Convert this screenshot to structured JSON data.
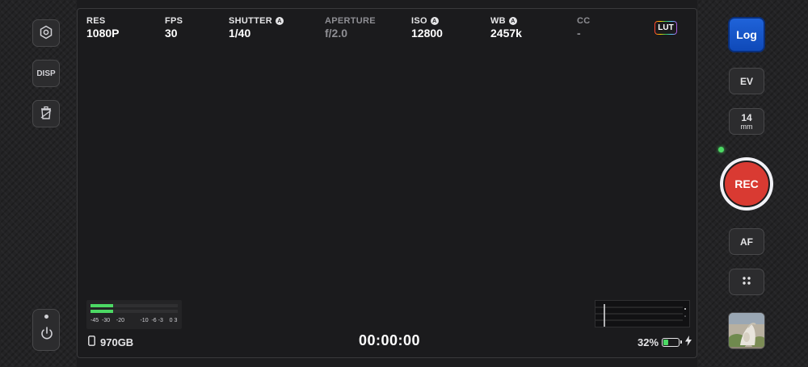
{
  "params": [
    {
      "label": "RES",
      "value": "1080P",
      "auto": false,
      "dim": false
    },
    {
      "label": "FPS",
      "value": "30",
      "auto": false,
      "dim": false
    },
    {
      "label": "SHUTTER",
      "value": "1/40",
      "auto": true,
      "dim": false
    },
    {
      "label": "APERTURE",
      "value": "f/2.0",
      "auto": false,
      "dim": true
    },
    {
      "label": "ISO",
      "value": "12800",
      "auto": true,
      "dim": false
    },
    {
      "label": "WB",
      "value": "2457k",
      "auto": true,
      "dim": false
    },
    {
      "label": "CC",
      "value": "-",
      "auto": false,
      "dim": true
    }
  ],
  "auto_badge": "A",
  "lut_label": "LUT",
  "left_buttons": {
    "settings_icon": "hexagon-settings-icon",
    "disp_label": "DISP",
    "clear_icon": "trash-clip-icon",
    "power_icon": "power-icon"
  },
  "audio_meter": {
    "scale": "-45  -30    -20          -10  -6 -3    0 3",
    "levels": [
      0.26,
      0.26
    ]
  },
  "storage": {
    "icon": "phone-icon",
    "value": "970GB"
  },
  "timecode": "00:00:00",
  "battery": {
    "percent": "32%",
    "level": 0.32,
    "charging_icon": "bolt-icon"
  },
  "right_buttons": {
    "log_label": "Log",
    "ev_label": "EV",
    "lens_value": "14",
    "lens_unit": "mm",
    "rec_label": "REC",
    "af_label": "AF",
    "grid_icon": "four-dots-icon",
    "thumbnail": "gallery-thumbnail"
  },
  "colors": {
    "accent_blue": "#1f63d9",
    "rec_red": "#d93a32",
    "meter_green": "#4cd964"
  }
}
